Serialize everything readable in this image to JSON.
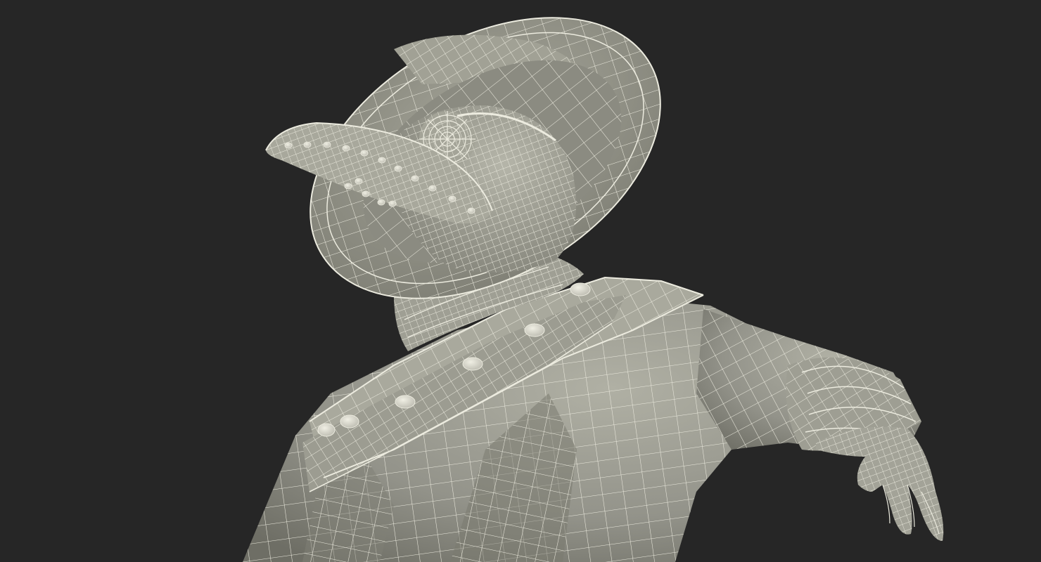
{
  "scene": {
    "subject": "plague-doctor-wireframe-render",
    "colors": {
      "background": "#262626",
      "surface": "#9a9a8e",
      "surface_dark": "#76766b",
      "surface_light": "#b2b2a6",
      "wire": "#ecebdf",
      "shadow": "#5e5e55"
    }
  }
}
